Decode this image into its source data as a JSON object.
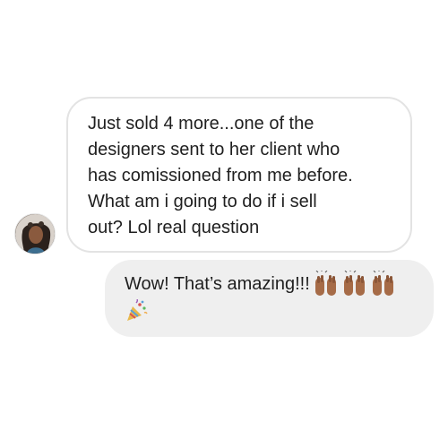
{
  "conversation": {
    "incoming": {
      "text": "Just sold 4 more...one of the\ndesigners sent to her client who\nhas comissioned from me before.\nWhat am i going to do if i sell\nout? Lol real question"
    },
    "outgoing": {
      "text": "Wow! That’s amazing!!!",
      "emojis": [
        "raising-hands-emoji",
        "raising-hands-emoji",
        "raising-hands-emoji",
        "party-popper-emoji"
      ]
    }
  },
  "colors": {
    "incoming_bubble_border": "#e3e3e3",
    "outgoing_bubble_bg": "#efefef",
    "text": "#1f1f1f"
  }
}
